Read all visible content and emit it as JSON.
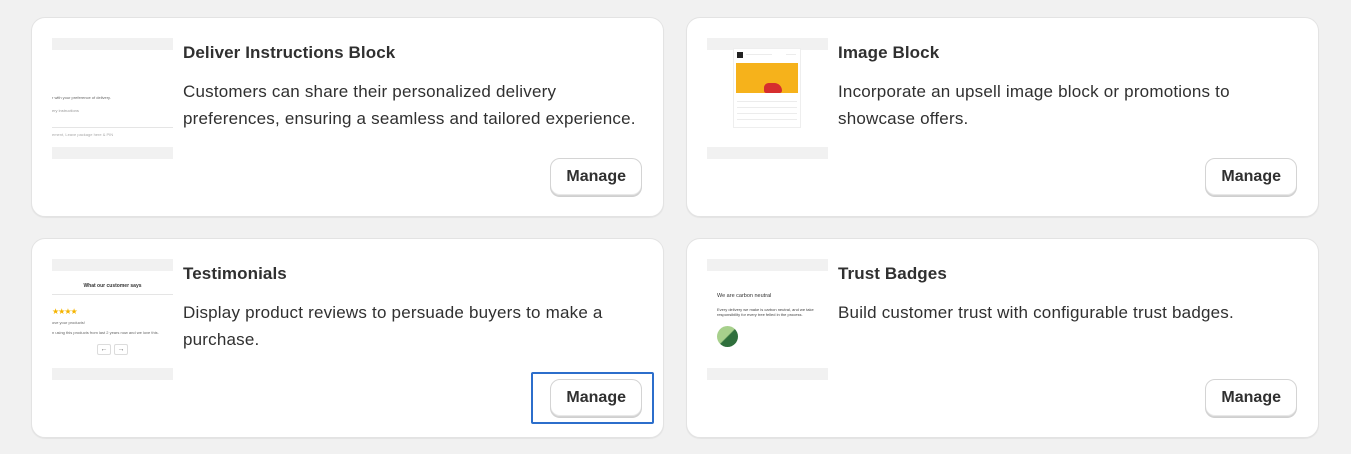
{
  "cards": [
    {
      "title": "Deliver Instructions Block",
      "description": "Customers can share their personalized delivery preferences, ensuring a seamless and tailored experience.",
      "button_label": "Manage",
      "preview": {
        "line1": "r with your preference of delivery.",
        "line2": "ery instructions",
        "line3": "ement, Leave package here & PIN"
      }
    },
    {
      "title": "Image Block",
      "description": "Incorporate an upsell image block or promotions to showcase offers.",
      "button_label": "Manage"
    },
    {
      "title": "Testimonials",
      "description": "Display product reviews to persuade buyers to make a purchase.",
      "button_label": "Manage",
      "preview": {
        "heading": "What our customer says",
        "stars": "★★★★",
        "line1": "ove your products!",
        "line2": "n using this products from last 2 years now and we love this.",
        "prev": "←",
        "next": "→"
      }
    },
    {
      "title": "Trust Badges",
      "description": "Build customer trust with configurable trust badges.",
      "button_label": "Manage",
      "preview": {
        "heading": "We are carbon neutral",
        "body": "Every delivery we make is carbon neutral, and we take responsibility for every tree felled in the process."
      }
    }
  ],
  "colors": {
    "page_bg": "#f1f1f1",
    "card_bg": "#ffffff",
    "focus_ring": "#2c6ecb",
    "star": "#f5b400",
    "banner": "#f6b21b"
  }
}
